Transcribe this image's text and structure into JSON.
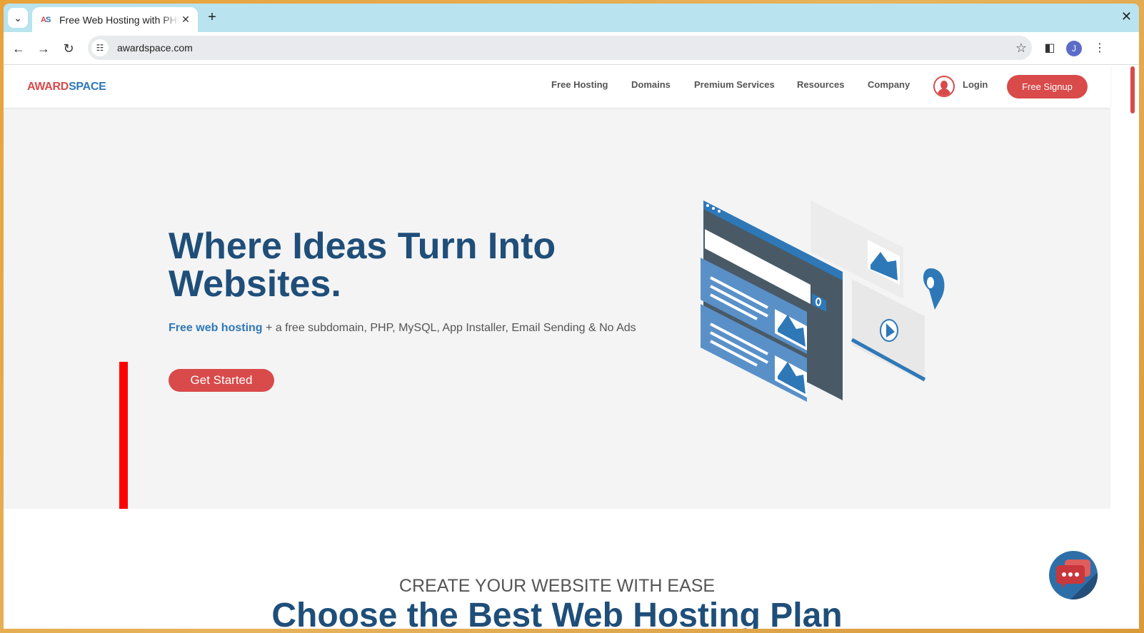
{
  "browser": {
    "tab_title": "Free Web Hosting with PHP, MySQL",
    "favicon_text_a": "A",
    "favicon_text_s": "S",
    "url": "awardspace.com",
    "profile_initial": "J"
  },
  "site": {
    "logo_award": "AWARD",
    "logo_space": "SPACE",
    "nav": [
      "Free Hosting",
      "Domains",
      "Premium Services",
      "Resources",
      "Company"
    ],
    "login_label": "Login",
    "signup_label": "Free Signup"
  },
  "hero": {
    "title": "Where Ideas Turn Into Websites.",
    "subtitle_highlight": "Free web hosting",
    "subtitle_rest": " + a free subdomain, PHP, MySQL, App Installer, Email Sending & No Ads",
    "cta_label": "Get Started"
  },
  "plans": {
    "kicker": "CREATE YOUR WEBSITE WITH EASE",
    "title": "Choose the Best Web Hosting Plan"
  },
  "colors": {
    "brand_red": "#d94a4a",
    "brand_blue": "#1f4e79",
    "accent_blue": "#2e78b8",
    "annotation_arrow": "#ff0000"
  }
}
